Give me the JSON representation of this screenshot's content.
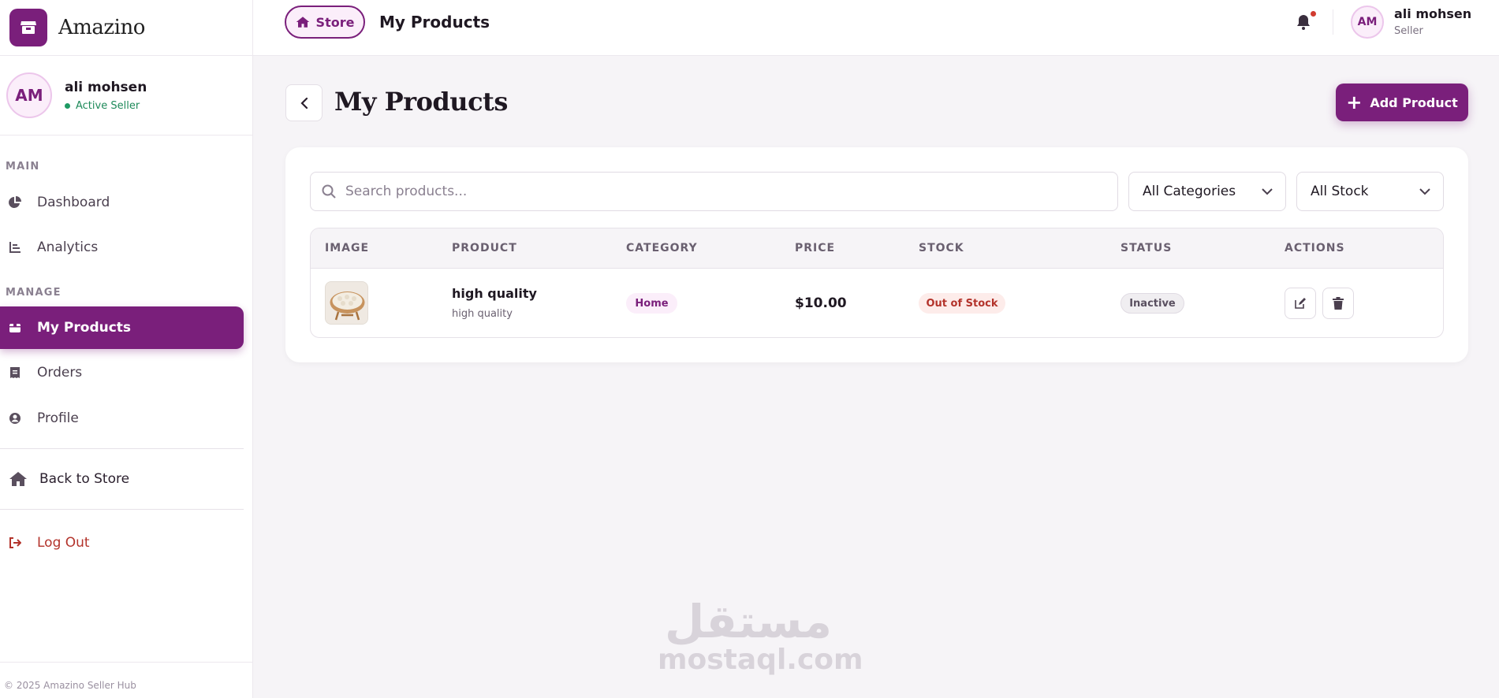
{
  "brand": {
    "name": "Amazino"
  },
  "sidebar": {
    "user": {
      "initials": "AM",
      "name": "ali mohsen",
      "status": "Active Seller"
    },
    "section_main": "MAIN",
    "section_manage": "MANAGE",
    "items": [
      {
        "label": "Dashboard",
        "icon": "pie-chart-icon"
      },
      {
        "label": "Analytics",
        "icon": "bar-chart-icon"
      },
      {
        "label": "My Products",
        "icon": "box-icon",
        "active": true
      },
      {
        "label": "Orders",
        "icon": "receipt-icon"
      },
      {
        "label": "Profile",
        "icon": "user-circle-icon"
      }
    ],
    "back_to_store": "Back to Store",
    "logout": "Log Out",
    "footer": "© 2025 Amazino Seller Hub"
  },
  "topbar": {
    "store_label": "Store",
    "title": "My Products",
    "user": {
      "initials": "AM",
      "name": "ali mohsen",
      "role": "Seller"
    }
  },
  "main": {
    "title": "My Products",
    "add_button": "Add Product",
    "search_placeholder": "Search products...",
    "category_filter": "All Categories",
    "stock_filter": "All Stock",
    "columns": [
      "IMAGE",
      "PRODUCT",
      "CATEGORY",
      "PRICE",
      "STOCK",
      "STATUS",
      "ACTIONS"
    ],
    "rows": [
      {
        "name": "high quality",
        "description": "high quality",
        "category": "Home",
        "price": "$10.00",
        "stock": "Out of Stock",
        "status": "Inactive"
      }
    ]
  },
  "watermark": {
    "arabic": "مستقل",
    "latin": "mostaql.com"
  },
  "colors": {
    "accent": "#7a1f7b",
    "success": "#1e9a63",
    "danger": "#b3332b"
  }
}
